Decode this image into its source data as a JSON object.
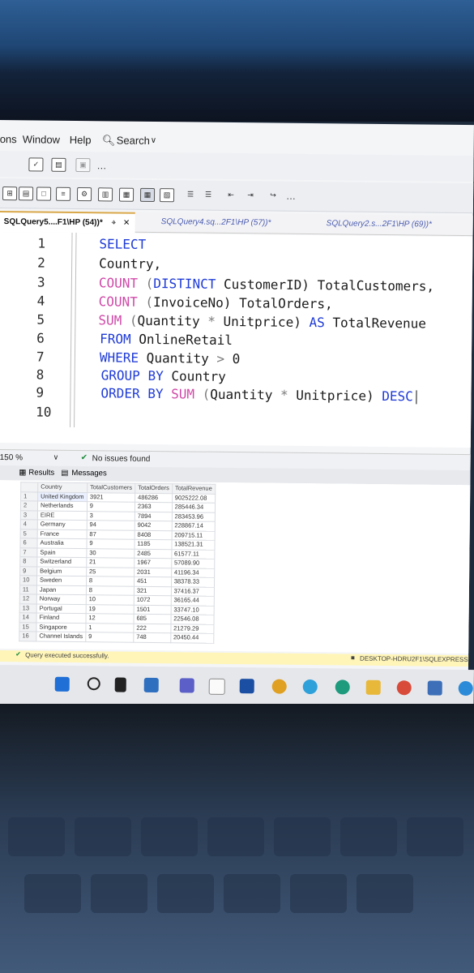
{
  "menubar": {
    "items": [
      "ons",
      "Window",
      "Help"
    ],
    "search_label": "Search"
  },
  "tabs": [
    {
      "label": "SQLQuery5....F1\\HP (54))*",
      "active": true
    },
    {
      "label": "SQLQuery4.sq...2F1\\HP (57))*",
      "active": false
    },
    {
      "label": "SQLQuery2.s...2F1\\HP (69))*",
      "active": false
    }
  ],
  "editor": {
    "line_numbers": [
      "1",
      "2",
      "3",
      "4",
      "5",
      "6",
      "7",
      "8",
      "9",
      "10"
    ],
    "lines": [
      [
        {
          "t": "SELECT",
          "c": "kw"
        }
      ],
      [
        {
          "t": "Country,",
          "c": "tx"
        }
      ],
      [
        {
          "t": "COUNT",
          "c": "fn"
        },
        {
          "t": " (",
          "c": "op"
        },
        {
          "t": "DISTINCT",
          "c": "kw"
        },
        {
          "t": " CustomerID) TotalCustomers,",
          "c": "tx"
        }
      ],
      [
        {
          "t": "COUNT",
          "c": "fn"
        },
        {
          "t": " (",
          "c": "op"
        },
        {
          "t": "InvoiceNo) TotalOrders,",
          "c": "tx"
        }
      ],
      [
        {
          "t": "SUM",
          "c": "fn"
        },
        {
          "t": " (",
          "c": "op"
        },
        {
          "t": "Quantity ",
          "c": "tx"
        },
        {
          "t": "*",
          "c": "op"
        },
        {
          "t": " Unitprice) ",
          "c": "tx"
        },
        {
          "t": "AS",
          "c": "kw"
        },
        {
          "t": " TotalRevenue",
          "c": "tx"
        }
      ],
      [
        {
          "t": "FROM",
          "c": "kw"
        },
        {
          "t": " OnlineRetail",
          "c": "tx"
        }
      ],
      [
        {
          "t": "WHERE",
          "c": "kw"
        },
        {
          "t": " Quantity ",
          "c": "tx"
        },
        {
          "t": ">",
          "c": "op"
        },
        {
          "t": " 0",
          "c": "tx"
        }
      ],
      [
        {
          "t": "GROUP BY",
          "c": "kw"
        },
        {
          "t": " Country",
          "c": "tx"
        }
      ],
      [
        {
          "t": "ORDER BY",
          "c": "kw"
        },
        {
          "t": " ",
          "c": "tx"
        },
        {
          "t": "SUM",
          "c": "fn"
        },
        {
          "t": " (",
          "c": "op"
        },
        {
          "t": "Quantity ",
          "c": "tx"
        },
        {
          "t": "*",
          "c": "op"
        },
        {
          "t": " Unitprice) ",
          "c": "tx"
        },
        {
          "t": "DESC",
          "c": "kw"
        }
      ],
      []
    ]
  },
  "status": {
    "zoom": "150 %",
    "issues": "No issues found"
  },
  "result_tabs": {
    "results": "Results",
    "messages": "Messages"
  },
  "grid": {
    "columns": [
      "Country",
      "TotalCustomers",
      "TotalOrders",
      "TotalRevenue"
    ],
    "rows": [
      [
        "1",
        "United Kingdom",
        "3921",
        "486286",
        "9025222.08"
      ],
      [
        "2",
        "Netherlands",
        "9",
        "2363",
        "285446.34"
      ],
      [
        "3",
        "EIRE",
        "3",
        "7894",
        "283453.96"
      ],
      [
        "4",
        "Germany",
        "94",
        "9042",
        "228867.14"
      ],
      [
        "5",
        "France",
        "87",
        "8408",
        "209715.11"
      ],
      [
        "6",
        "Australia",
        "9",
        "1185",
        "138521.31"
      ],
      [
        "7",
        "Spain",
        "30",
        "2485",
        "61577.11"
      ],
      [
        "8",
        "Switzerland",
        "21",
        "1967",
        "57089.90"
      ],
      [
        "9",
        "Belgium",
        "25",
        "2031",
        "41196.34"
      ],
      [
        "10",
        "Sweden",
        "8",
        "451",
        "38378.33"
      ],
      [
        "11",
        "Japan",
        "8",
        "321",
        "37416.37"
      ],
      [
        "12",
        "Norway",
        "10",
        "1072",
        "36165.44"
      ],
      [
        "13",
        "Portugal",
        "19",
        "1501",
        "33747.10"
      ],
      [
        "14",
        "Finland",
        "12",
        "685",
        "22546.08"
      ],
      [
        "15",
        "Singapore",
        "1",
        "222",
        "21279.29"
      ],
      [
        "16",
        "Channel Islands",
        "9",
        "748",
        "20450.44"
      ]
    ]
  },
  "execbar": {
    "message": "Query executed successfully.",
    "server": "DESKTOP-HDRU2F1\\SQLEXPRESS"
  }
}
